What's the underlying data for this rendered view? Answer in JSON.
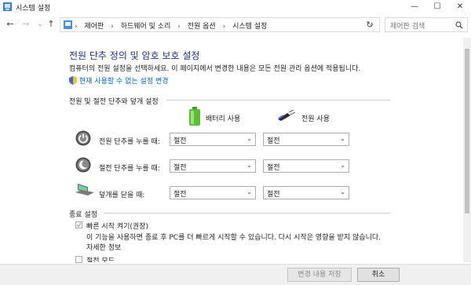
{
  "window": {
    "title": "시스템 설정",
    "minimize": "—",
    "maximize": "☐",
    "close": "✕"
  },
  "nav": {
    "back": "←",
    "forward": "→",
    "up": "↑",
    "dropdown": "⌄",
    "refresh": "↻"
  },
  "breadcrumb": {
    "items": [
      "제어판",
      "하드웨어 및 소리",
      "전원 옵션",
      "시스템 설정"
    ],
    "sep": "›"
  },
  "search": {
    "placeholder": "제어판 검색"
  },
  "page": {
    "title": "전원 단추 정의 및 암호 보호 설정",
    "description": "컴퓨터의 전원 설정을 선택하세요. 이 페이지에서 변경한 내용은 모든 전원 관리 옵션에 적용됩니다.",
    "admin_link": "현재 사용할 수 없는 설정 변경"
  },
  "section1": {
    "title": "전원 및 절전 단추와 덮개 설정",
    "col_battery": "배터리 사용",
    "col_ac": "전원 사용",
    "rows": [
      {
        "label": "전원 단추를 누를 때:",
        "battery": "절전",
        "ac": "절전"
      },
      {
        "label": "절전 단추를 누를 때:",
        "battery": "절전",
        "ac": "절전"
      },
      {
        "label": "덮개를 닫을 때:",
        "battery": "절전",
        "ac": "절전"
      }
    ]
  },
  "section2": {
    "title": "종료 설정",
    "fast_startup": "빠른 시작 켜기(권장)",
    "fast_startup_desc": "이 기능을 사용하면 종료 후 PC를 더 빠르게 시작할 수 있습니다. 다시 시작은 영향을 받지 않습니다.",
    "more_link": "자세한 정보",
    "next_item": "절전 모드"
  },
  "footer": {
    "save": "변경 내용 저장",
    "cancel": "취소"
  },
  "colors": {
    "title": "#1e3287",
    "link": "#0066cc"
  }
}
